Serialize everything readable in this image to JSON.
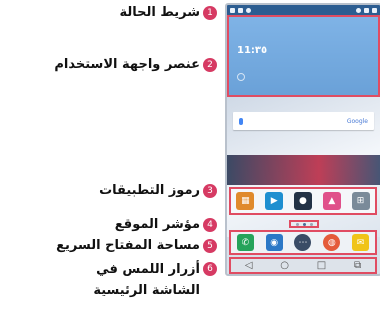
{
  "callouts": [
    {
      "number": "1",
      "label": "شريط الحالة"
    },
    {
      "number": "2",
      "label": "عنصر واجهة الاستخدام"
    },
    {
      "number": "3",
      "label": "رموز التطبيقات"
    },
    {
      "number": "4",
      "label": "مؤشر الموقع"
    },
    {
      "number": "5",
      "label": "مساحة المفتاح السريع"
    },
    {
      "number": "6",
      "label": "أزرار اللمس في الشاشة الرئيسية"
    }
  ],
  "phone": {
    "clock": "11:٣٥",
    "search_brand": "Google",
    "nav_buttons": [
      "◁",
      "○",
      "□",
      "⧉"
    ],
    "highlight_color": "#e04c62",
    "marker_color": "#d63a63"
  }
}
